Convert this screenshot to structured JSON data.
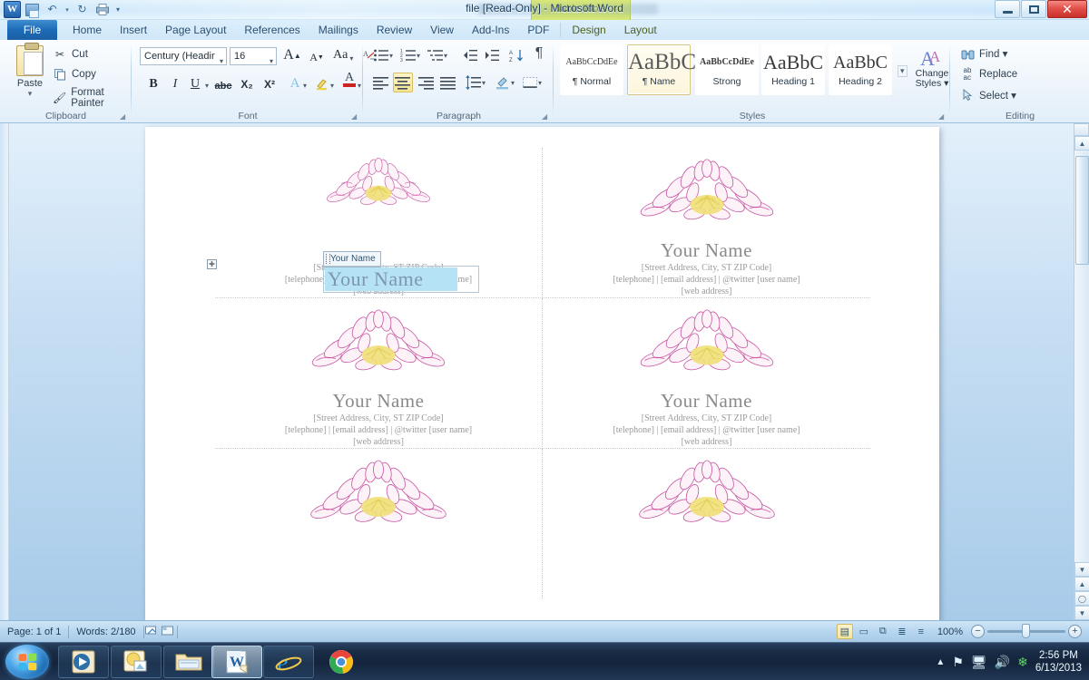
{
  "window": {
    "title": "file [Read-Only] - Microsoft Word",
    "contextual_tab_group": "Table Tools",
    "minimize_label": "Minimize",
    "restore_label": "Restore Down",
    "close_label": "Close"
  },
  "quick_access": {
    "app_icon": "word-icon",
    "items": [
      {
        "name": "save",
        "icon": "save-icon"
      },
      {
        "name": "undo",
        "icon": "undo-arrow-icon",
        "glyph": "↶"
      },
      {
        "name": "undo-dropdown",
        "glyph": "▾"
      },
      {
        "name": "redo",
        "icon": "redo-circular-arrow-icon",
        "glyph": "↻"
      },
      {
        "name": "print-preview",
        "icon": "print-preview-icon"
      },
      {
        "name": "customize-qat",
        "glyph": "▾"
      }
    ]
  },
  "ribbon": {
    "file_tab": "File",
    "tabs": [
      {
        "label": "Home",
        "active": true,
        "contextual": false
      },
      {
        "label": "Insert",
        "contextual": false
      },
      {
        "label": "Page Layout",
        "contextual": false
      },
      {
        "label": "References",
        "contextual": false
      },
      {
        "label": "Mailings",
        "contextual": false
      },
      {
        "label": "Review",
        "contextual": false
      },
      {
        "label": "View",
        "contextual": false
      },
      {
        "label": "Add-Ins",
        "contextual": false
      },
      {
        "label": "PDF",
        "contextual": false
      },
      {
        "label": "Design",
        "contextual": true
      },
      {
        "label": "Layout",
        "contextual": true
      }
    ],
    "collapse_glyph": "⌃",
    "help_glyph": "?",
    "groups": {
      "clipboard": {
        "label": "Clipboard",
        "paste": "Paste",
        "paste_caret": "▾",
        "cut": "Cut",
        "copy": "Copy",
        "format_painter": "Format Painter",
        "cut_icon": "scissors-icon",
        "copy_icon": "copy-icon",
        "format_painter_icon": "paintbrush-icon"
      },
      "font": {
        "label": "Font",
        "font_name": "Century (Headir",
        "font_name_full": "Century (Headings)",
        "font_size": "16",
        "grow_font": "A",
        "shrink_font": "A",
        "change_case": "Aa",
        "clear_formatting": "clear-formatting-icon",
        "bold": "B",
        "italic": "I",
        "underline": "U",
        "strikethrough": "abc",
        "subscript": "X₂",
        "superscript": "X²",
        "text_effects": "A",
        "highlight": "highlight-icon",
        "font_color": "A"
      },
      "paragraph": {
        "label": "Paragraph",
        "bullets": "bullets-icon",
        "numbering": "numbering-icon",
        "multilevel_list": "multilevel-list-icon",
        "decrease_indent": "decrease-indent-icon",
        "increase_indent": "increase-indent-icon",
        "sort": "sort-icon",
        "show_marks": "¶",
        "align_left": "align-left-icon",
        "align_center": "align-center-icon",
        "align_right": "align-right-icon",
        "justify": "justify-icon",
        "line_spacing": "line-spacing-icon",
        "shading": "shading-icon",
        "borders": "borders-icon",
        "active_alignment": "align-center"
      },
      "styles": {
        "label": "Styles",
        "items": [
          {
            "preview": "AaBbCcDdEе",
            "name": "¶ Normal",
            "selected": false,
            "preview_size": 11
          },
          {
            "preview": "AaBbС",
            "name": "¶ Name",
            "selected": true,
            "preview_size": 24
          },
          {
            "preview": "AaBbCcDdEе",
            "name": "Strong",
            "selected": false,
            "preview_size": 11
          },
          {
            "preview": "AaBbC",
            "name": "Heading 1",
            "selected": false,
            "preview_size": 22
          },
          {
            "preview": "AaBbC",
            "name": "Heading 2",
            "selected": false,
            "preview_size": 20
          }
        ],
        "more_glyph": "▾",
        "change_styles": "Change",
        "change_styles2": "Styles ▾"
      },
      "editing": {
        "label": "Editing",
        "find": "Find ▾",
        "replace": "Replace",
        "select": "Select ▾",
        "find_icon": "binoculars-icon",
        "replace_icon": "replace-icon",
        "select_icon": "select-pointer-icon"
      }
    }
  },
  "document": {
    "table_handle": "✚",
    "content_control_tag": "Your Name",
    "selected_text": "Your Name",
    "cards": [
      {
        "name": "Your Name",
        "address": "[Street Address, City, ST  ZIP Code]",
        "contact": "[telephone] | [email address] | @twitter [user name]",
        "web": "[web address]",
        "selected": true
      },
      {
        "name": "Your Name",
        "address": "[Street Address, City, ST  ZIP Code]",
        "contact": "[telephone] | [email address] | @twitter [user name]",
        "web": "[web address]",
        "selected": false
      },
      {
        "name": "Your Name",
        "address": "[Street Address, City, ST  ZIP Code]",
        "contact": "[telephone] | [email address] | @twitter [user name]",
        "web": "[web address]",
        "selected": false
      },
      {
        "name": "Your Name",
        "address": "[Street Address, City, ST  ZIP Code]",
        "contact": "[telephone] | [email address] | @twitter [user name]",
        "web": "[web address]",
        "selected": false
      },
      {
        "name": "",
        "address": "",
        "contact": "",
        "web": "",
        "selected": false
      },
      {
        "name": "",
        "address": "",
        "contact": "",
        "web": "",
        "selected": false
      }
    ],
    "image_alt": "lotus-flower-illustration"
  },
  "status_bar": {
    "page": "Page: 1 of 1",
    "words": "Words: 2/180",
    "proofing_icon": "proofing-errors-icon",
    "macro_icon": "record-macro-icon",
    "views": [
      {
        "name": "print-layout",
        "glyph": "▤",
        "active": true
      },
      {
        "name": "full-screen-reading",
        "glyph": "▭",
        "active": false
      },
      {
        "name": "web-layout",
        "glyph": "⧉",
        "active": false
      },
      {
        "name": "outline",
        "glyph": "≣",
        "active": false
      },
      {
        "name": "draft",
        "glyph": "≡",
        "active": false
      }
    ],
    "zoom": "100%",
    "zoom_out": "−",
    "zoom_in": "+"
  },
  "taskbar": {
    "start": "start-orb",
    "buttons": [
      {
        "name": "windows-media-player",
        "icon": "media-player-icon",
        "active": false
      },
      {
        "name": "photo-viewer",
        "icon": "photo-app-icon",
        "active": false
      },
      {
        "name": "windows-explorer",
        "icon": "folder-icon",
        "active": false
      },
      {
        "name": "microsoft-word",
        "icon": "word-icon",
        "active": true
      },
      {
        "name": "internet-explorer",
        "icon": "ie-icon",
        "active": false
      },
      {
        "name": "google-chrome",
        "icon": "chrome-icon",
        "active": false
      }
    ],
    "tray": {
      "show_hidden": "▲",
      "icons": [
        "action-center-flag-icon",
        "network-icon",
        "volume-icon",
        "antivirus-shield-icon"
      ],
      "time": "2:56 PM",
      "date": "6/13/2013"
    }
  },
  "colors": {
    "accent_blue": "#1d6bb6",
    "contextual_green": "#c9dc63",
    "selection_blue": "#b6e2f5",
    "close_red": "#c9302b",
    "flower_pink": "#cc3f9a",
    "flower_yellow": "#f1e06a"
  }
}
